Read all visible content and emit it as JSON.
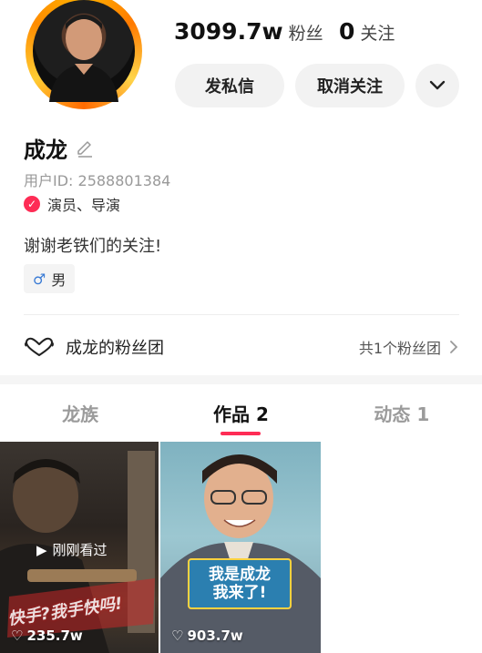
{
  "profile": {
    "followers_count": "3099.7w",
    "followers_label": "粉丝",
    "following_count": "0",
    "following_label": "关注",
    "name": "成龙",
    "user_id": "用户ID: 2588801384",
    "verification": "演员、导演",
    "bio": "谢谢老铁们的关注!",
    "gender_symbol": "♂",
    "gender": "男"
  },
  "actions": {
    "message": "发私信",
    "unfollow": "取消关注",
    "more_icon": "chevron-down-icon"
  },
  "fanclub": {
    "label": "成龙的粉丝团",
    "count": "共1个粉丝团",
    "icon": "heart-icon"
  },
  "tabs": [
    "龙族",
    "作品 2",
    "动态 1"
  ],
  "videos": [
    {
      "overlay": "刚刚看过",
      "likes": "235.7w",
      "caption": "快手?我手快吗!"
    },
    {
      "likes": "903.7w",
      "caption_line1": "我是成龙",
      "caption_line2": "我来了!"
    }
  ],
  "colors": {
    "accent": "#fe2c55",
    "ring": "#ff9a00"
  }
}
